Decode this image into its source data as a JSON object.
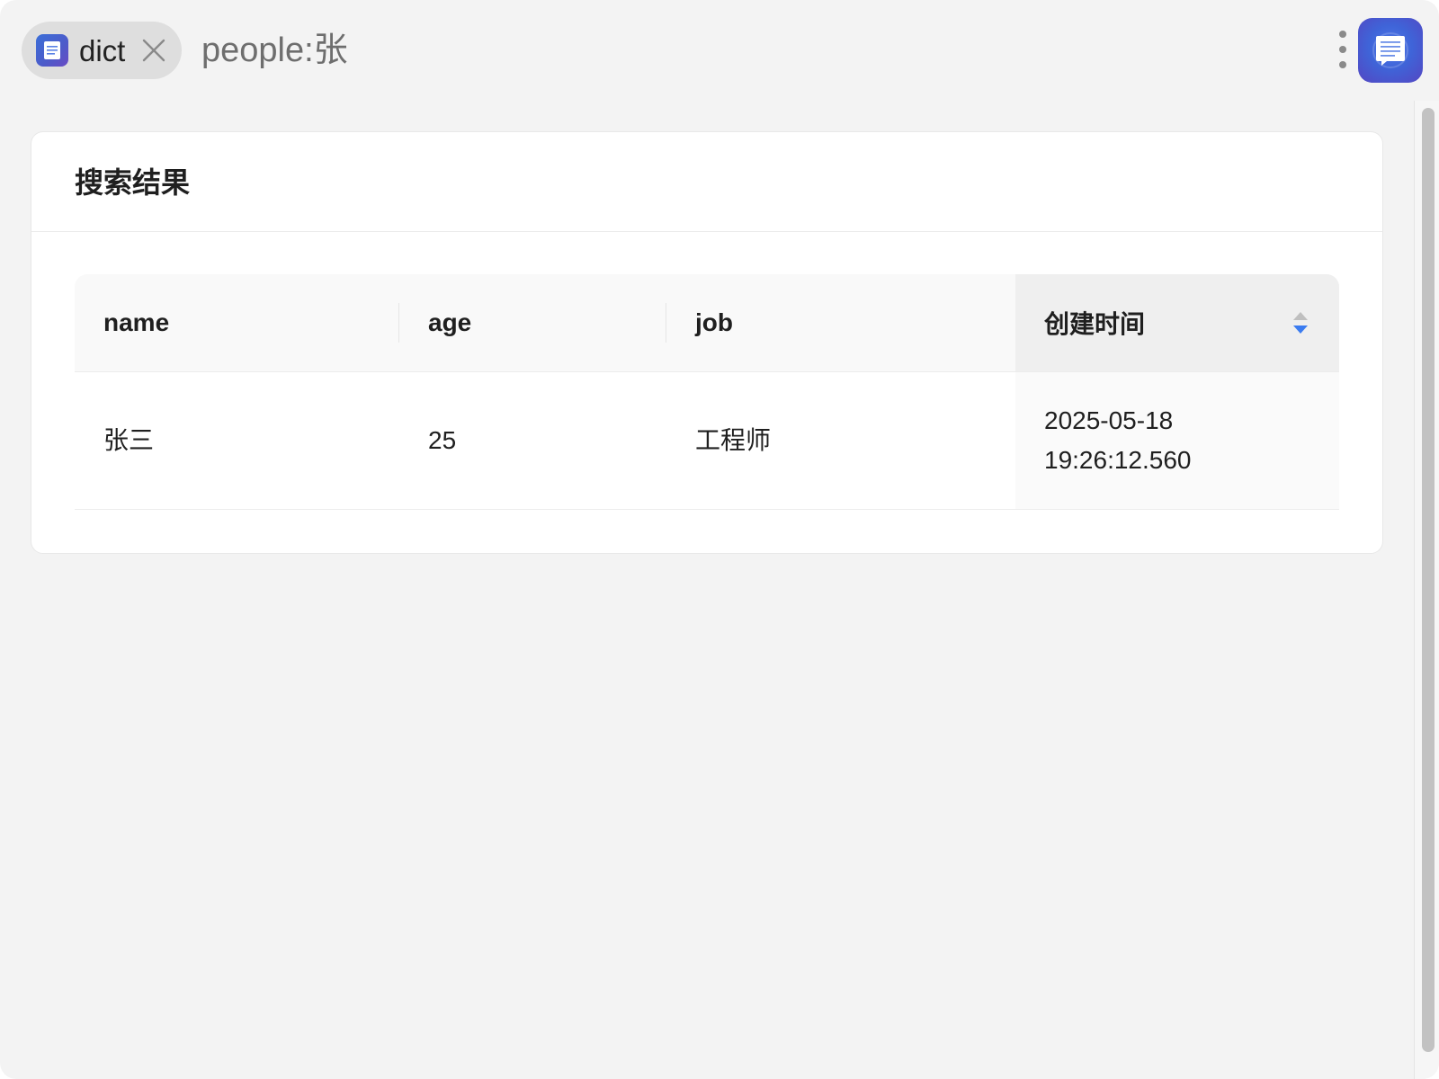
{
  "tab": {
    "label": "dict",
    "icon": "document-icon"
  },
  "query": "people:张",
  "app_logo": "document-chat-icon",
  "card": {
    "title": "搜索结果"
  },
  "table": {
    "columns": [
      "name",
      "age",
      "job",
      "创建时间"
    ],
    "sorted_column": "创建时间",
    "sort_direction": "descending",
    "rows": [
      {
        "name": "张三",
        "age": "25",
        "job": "工程师",
        "created_date": "2025-05-18",
        "created_time": "19:26:12.560"
      }
    ]
  },
  "colors": {
    "accent": "#3b7cf0",
    "logo": "#4a62d8"
  }
}
